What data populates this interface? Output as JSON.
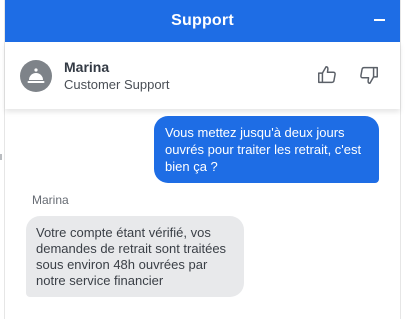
{
  "header": {
    "title": "Support",
    "minimize_icon": "minimize-icon",
    "background_color": "#1e6de5"
  },
  "agent": {
    "name": "Marina",
    "role": "Customer Support",
    "avatar_icon": "service-bell-icon",
    "avatar_color": "#7e8389"
  },
  "rating": {
    "thumbs_up_icon": "thumbs-up-icon",
    "thumbs_down_icon": "thumbs-down-icon"
  },
  "conversation": {
    "messages": [
      {
        "from": "user",
        "text": "Vous mettez jusqu'à deux jours ouvrés pour traiter les retrait, c'est bien ça ?"
      },
      {
        "from": "agent",
        "sender_label": "Marina",
        "text": "Votre compte étant vérifié, vos demandes de retrait sont traitées sous environ 48h ouvrées par notre service financier"
      }
    ]
  },
  "colors": {
    "user_bubble": "#1e6de5",
    "agent_bubble": "#e8e9eb"
  }
}
